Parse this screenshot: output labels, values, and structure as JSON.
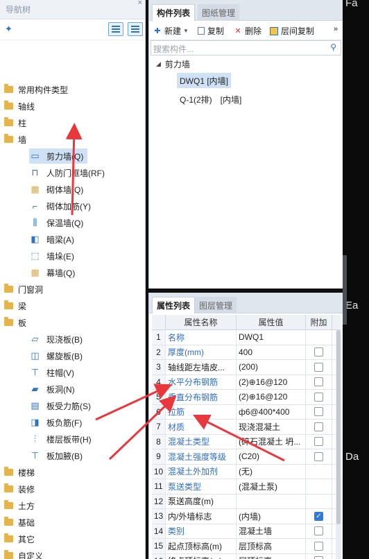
{
  "nav": {
    "title": "导航树",
    "close": "×",
    "tree": [
      {
        "label": "常用构件类型",
        "level": 0
      },
      {
        "label": "轴线",
        "level": 0
      },
      {
        "label": "柱",
        "level": 0
      },
      {
        "label": "墙",
        "level": 0
      },
      {
        "label": "剪力墙(Q)",
        "level": 1,
        "icon": "shear-wall-icon",
        "selected": true
      },
      {
        "label": "人防门框墙(RF)",
        "level": 1,
        "icon": "civil-defense-door-wall-icon"
      },
      {
        "label": "砌体墙(Q)",
        "level": 1,
        "icon": "masonry-wall-icon"
      },
      {
        "label": "砌体加筋(Y)",
        "level": 1,
        "icon": "masonry-reinforcement-icon"
      },
      {
        "label": "保温墙(Q)",
        "level": 1,
        "icon": "insulation-wall-icon"
      },
      {
        "label": "暗梁(A)",
        "level": 1,
        "icon": "hidden-beam-icon"
      },
      {
        "label": "墙垛(E)",
        "level": 1,
        "icon": "wall-buttress-icon"
      },
      {
        "label": "幕墙(Q)",
        "level": 1,
        "icon": "curtain-wall-icon"
      },
      {
        "label": "门窗洞",
        "level": 0
      },
      {
        "label": "梁",
        "level": 0
      },
      {
        "label": "板",
        "level": 0
      },
      {
        "label": "现浇板(B)",
        "level": 1,
        "icon": "cast-slab-icon"
      },
      {
        "label": "螺旋板(B)",
        "level": 1,
        "icon": "spiral-slab-icon"
      },
      {
        "label": "柱帽(V)",
        "level": 1,
        "icon": "column-cap-icon"
      },
      {
        "label": "板洞(N)",
        "level": 1,
        "icon": "slab-hole-icon"
      },
      {
        "label": "板受力筋(S)",
        "level": 1,
        "icon": "slab-main-rebar-icon"
      },
      {
        "label": "板负筋(F)",
        "level": 1,
        "icon": "slab-negative-rebar-icon"
      },
      {
        "label": "楼层板带(H)",
        "level": 1,
        "icon": "floor-slab-band-icon"
      },
      {
        "label": "板加腋(B)",
        "level": 1,
        "icon": "slab-haunch-icon"
      },
      {
        "label": "楼梯",
        "level": 0
      },
      {
        "label": "装修",
        "level": 0
      },
      {
        "label": "土方",
        "level": 0
      },
      {
        "label": "基础",
        "level": 0
      },
      {
        "label": "其它",
        "level": 0
      },
      {
        "label": "自定义",
        "level": 0
      }
    ]
  },
  "list_panel": {
    "tabs": [
      "构件列表",
      "图纸管理"
    ],
    "close": "×",
    "toolbar": {
      "new": "新建",
      "copy": "复制",
      "delete": "删除",
      "floor_copy": "层间复制",
      "more": "»"
    },
    "search_placeholder": "搜索构件...",
    "group": "剪力墙",
    "items": [
      {
        "label": "DWQ1 [内墙]",
        "selected": true
      },
      {
        "label": "Q-1(2排)　[内墙]",
        "selected": false
      }
    ]
  },
  "prop_panel": {
    "tabs": [
      "属性列表",
      "图层管理"
    ],
    "columns": [
      "属性名称",
      "属性值",
      "附加"
    ],
    "rows": [
      {
        "n": "1",
        "name": "名称",
        "value": "DWQ1",
        "blue": true,
        "check": "none"
      },
      {
        "n": "2",
        "name": "厚度(mm)",
        "value": "400",
        "blue": true,
        "check": "off"
      },
      {
        "n": "3",
        "name": "轴线距左墙皮...",
        "value": "(200)",
        "blue": false,
        "check": "off"
      },
      {
        "n": "4",
        "name": "水平分布钢筋",
        "value": "(2)⊕16@120",
        "blue": true,
        "check": "off"
      },
      {
        "n": "5",
        "name": "垂直分布钢筋",
        "value": "(2)⊕16@120",
        "blue": true,
        "check": "off"
      },
      {
        "n": "6",
        "name": "拉筋",
        "value": "ф6@400*400",
        "blue": true,
        "check": "off"
      },
      {
        "n": "7",
        "name": "材质",
        "value": "现浇混凝土",
        "blue": true,
        "check": "off"
      },
      {
        "n": "8",
        "name": "混凝土类型",
        "value": "(碎石混凝土 坍...",
        "blue": true,
        "check": "off"
      },
      {
        "n": "9",
        "name": "混凝土强度等级",
        "value": "(C20)",
        "blue": true,
        "check": "off"
      },
      {
        "n": "10",
        "name": "混凝土外加剂",
        "value": "(无)",
        "blue": true,
        "check": "none"
      },
      {
        "n": "11",
        "name": "泵送类型",
        "value": "(混凝土泵)",
        "blue": true,
        "check": "none"
      },
      {
        "n": "12",
        "name": "泵送高度(m)",
        "value": "",
        "blue": false,
        "check": "none"
      },
      {
        "n": "13",
        "name": "内/外墙标志",
        "value": "(内墙)",
        "blue": false,
        "check": "on"
      },
      {
        "n": "14",
        "name": "类别",
        "value": "混凝土墙",
        "blue": true,
        "check": "off"
      },
      {
        "n": "15",
        "name": "起点顶标高(m)",
        "value": "层顶标高",
        "blue": false,
        "check": "off"
      },
      {
        "n": "16",
        "name": "终点顶标高(m)",
        "value": "层顶标高",
        "blue": false,
        "check": "off"
      }
    ]
  },
  "side_strip": {
    "labels": [
      "Fa",
      "Ea",
      "Da"
    ]
  },
  "colors": {
    "accent": "#2f72c4",
    "selection": "#cfe1f5",
    "arrow": "#e8383d",
    "folder": "#e5b44a"
  }
}
